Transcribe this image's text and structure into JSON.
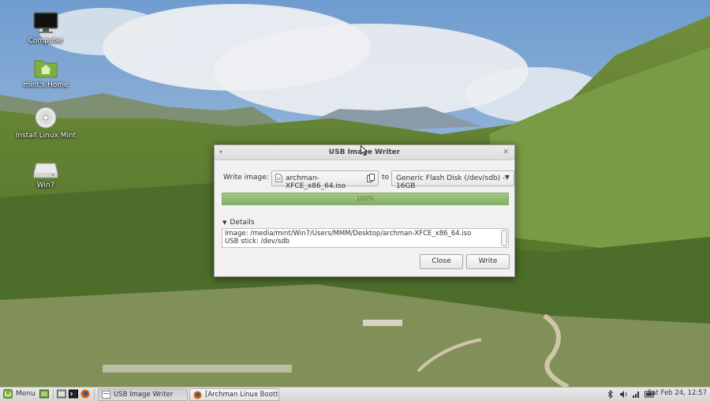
{
  "desktop": {
    "icons": [
      {
        "label": "Computer",
        "icon": "computer-monitor-icon"
      },
      {
        "label": "mint's Home",
        "icon": "home-folder-icon"
      },
      {
        "label": "Install Linux Mint",
        "icon": "disc-icon"
      },
      {
        "label": "Win7",
        "icon": "drive-icon"
      }
    ]
  },
  "dialog": {
    "title": "USB Image Writer",
    "write_image_label": "Write image:",
    "iso_file": "archman-XFCE_x86_64.iso",
    "to_label": "to",
    "target_device": "Generic Flash Disk (/dev/sdb) - 16GB",
    "progress": {
      "fraction": 1.0,
      "label": "100%"
    },
    "details_label": "Details",
    "details_lines": [
      "Image: /media/mint/Win7/Users/MMM/Desktop/archman-XFCE_x86_64.iso",
      "USB stick: /dev/sdb"
    ],
    "close_label": "Close",
    "write_label": "Write"
  },
  "taskbar": {
    "menu_label": "Menu",
    "tasks": [
      {
        "label": "USB Image Writer",
        "active": true
      },
      {
        "label": "[Archman Linux Boott..."
      }
    ],
    "clock": "Sat Feb 24, 12:57"
  },
  "colors": {
    "progress_fill": "#8ab76b",
    "mint_green": "#7fb03f",
    "taskbar_bg": "#e0e0e0"
  }
}
